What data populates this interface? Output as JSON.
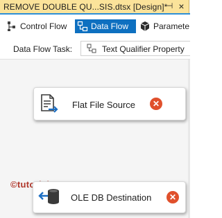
{
  "document_tab": {
    "title": "REMOVE DOUBLE QU...SIS.dtsx [Design]*",
    "pin_glyph": "⊣",
    "close_glyph": "×"
  },
  "designer_tabs": [
    {
      "label": "Control Flow",
      "icon": "control-flow-icon",
      "active": false
    },
    {
      "label": "Data Flow",
      "icon": "data-flow-icon",
      "active": true
    },
    {
      "label": "Paramete",
      "icon": "parameters-icon",
      "active": false
    }
  ],
  "taskbar": {
    "label": "Data Flow Task:",
    "selected_task": "Text Qualifier Property"
  },
  "components": [
    {
      "label": "Flat File Source",
      "icon": "flat-file-source-icon",
      "status_icon": "error-icon"
    },
    {
      "label": "OLE DB Destination",
      "icon": "ole-db-destination-icon",
      "status_icon": "error-icon"
    }
  ],
  "watermark": "©tutorialgateway.org",
  "colors": {
    "tab_active_bg": "#fbe39a",
    "accent": "#0e70c0",
    "error": "#e0502c",
    "watermark": "#b0372b"
  }
}
